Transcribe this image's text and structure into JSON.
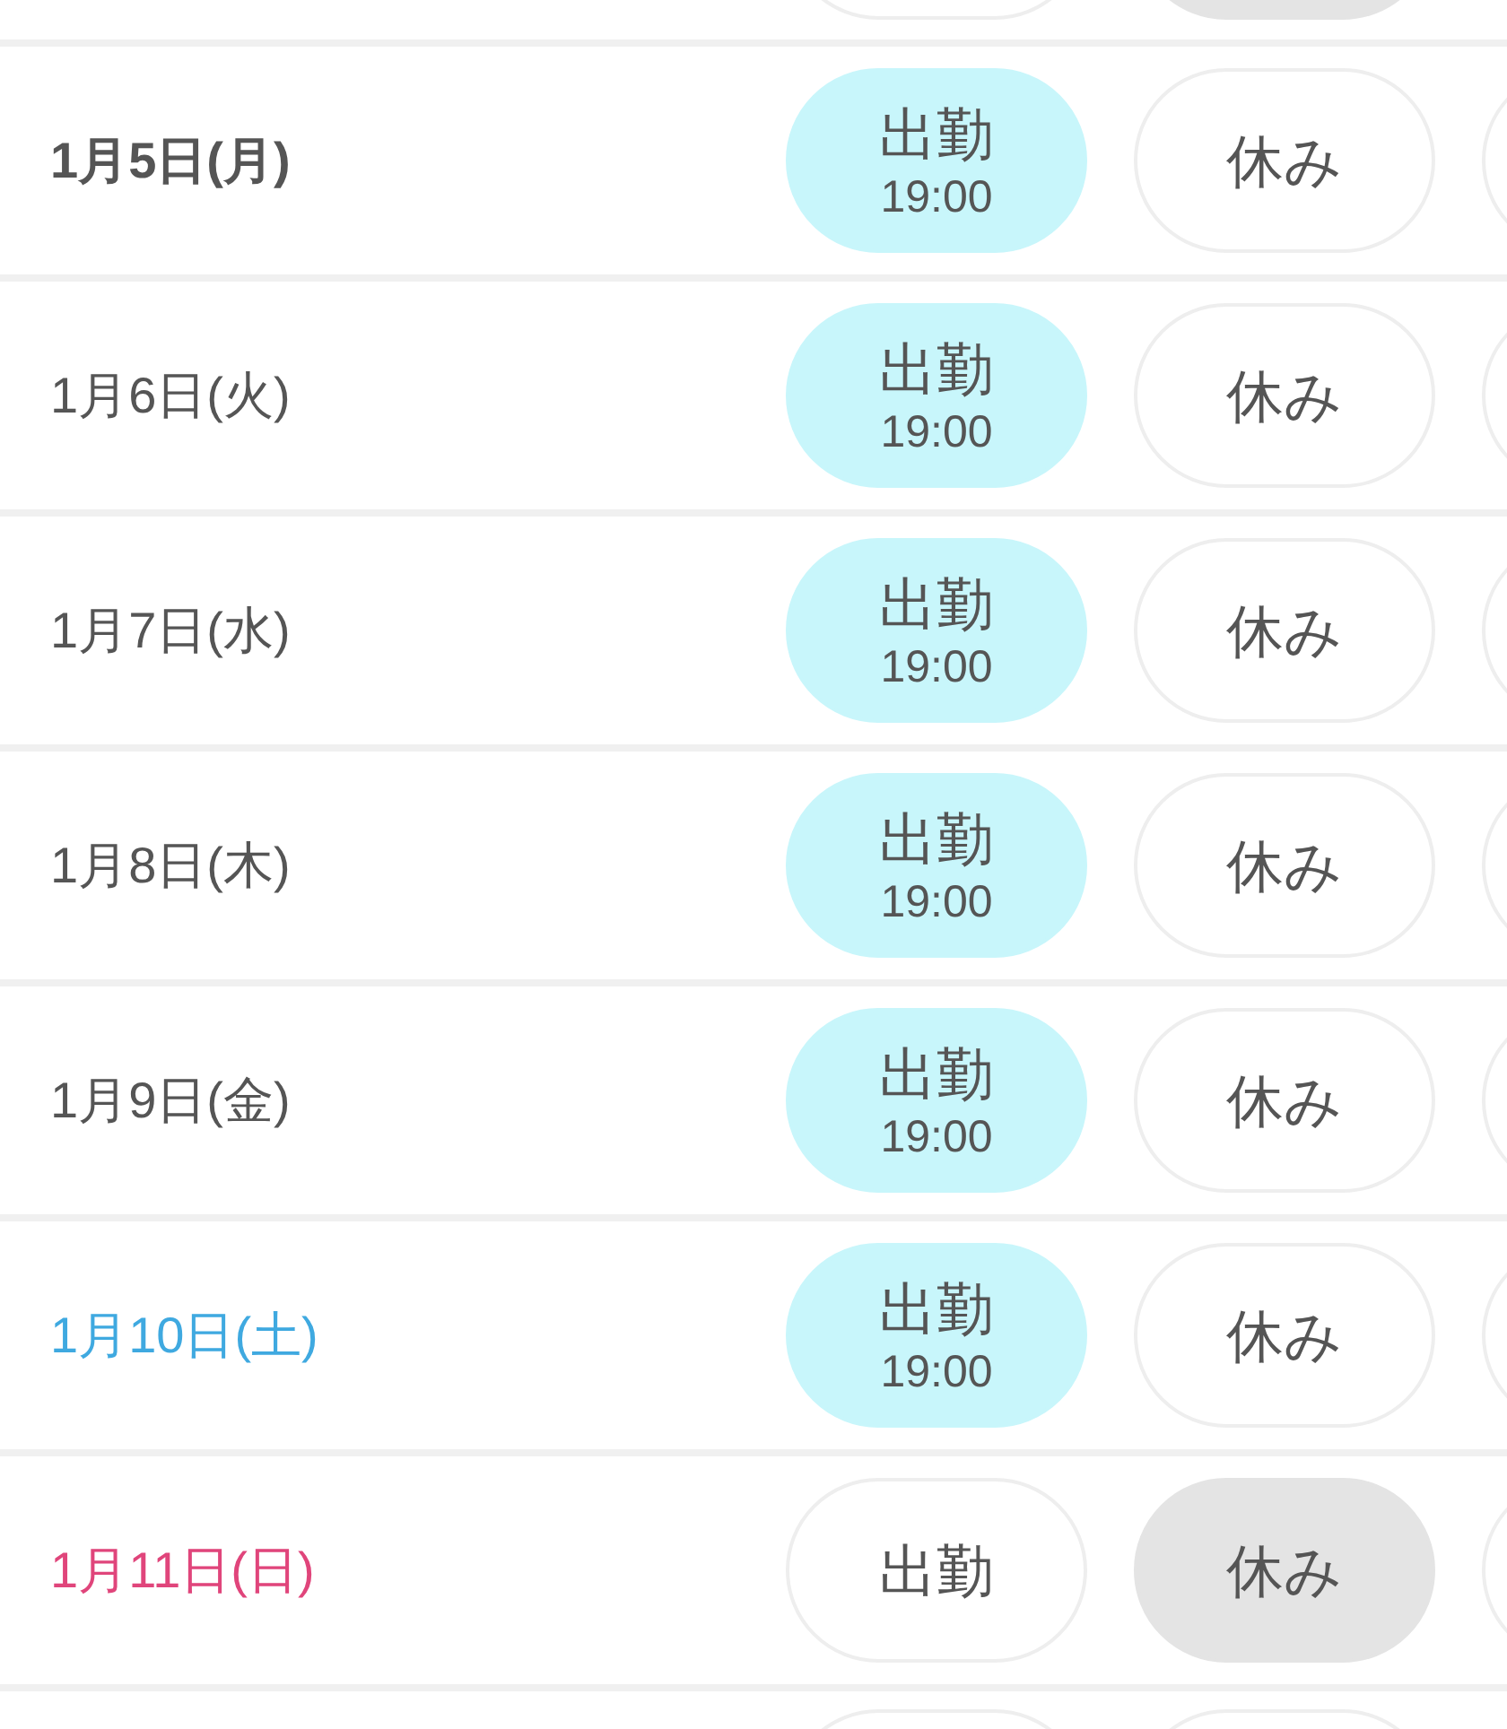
{
  "row_above": {
    "work_selected": false,
    "off_selected": true
  },
  "rows": [
    {
      "date": "1月5日(月)",
      "color": "#555555",
      "today": true,
      "work": {
        "label": "出勤",
        "time": "19:00",
        "selected": true
      },
      "off": {
        "label": "休み",
        "selected": false
      }
    },
    {
      "date": "1月6日(火)",
      "color": "#555555",
      "today": false,
      "work": {
        "label": "出勤",
        "time": "19:00",
        "selected": true
      },
      "off": {
        "label": "休み",
        "selected": false
      }
    },
    {
      "date": "1月7日(水)",
      "color": "#555555",
      "today": false,
      "work": {
        "label": "出勤",
        "time": "19:00",
        "selected": true
      },
      "off": {
        "label": "休み",
        "selected": false
      }
    },
    {
      "date": "1月8日(木)",
      "color": "#555555",
      "today": false,
      "work": {
        "label": "出勤",
        "time": "19:00",
        "selected": true
      },
      "off": {
        "label": "休み",
        "selected": false
      }
    },
    {
      "date": "1月9日(金)",
      "color": "#555555",
      "today": false,
      "work": {
        "label": "出勤",
        "time": "19:00",
        "selected": true
      },
      "off": {
        "label": "休み",
        "selected": false
      }
    },
    {
      "date": "1月10日(土)",
      "color": "#3fa9e0",
      "today": false,
      "work": {
        "label": "出勤",
        "time": "19:00",
        "selected": true
      },
      "off": {
        "label": "休み",
        "selected": false
      }
    },
    {
      "date": "1月11日(日)",
      "color": "#e0457b",
      "today": false,
      "work": {
        "label": "出勤",
        "selected": false
      },
      "off": {
        "label": "休み",
        "selected": true
      }
    }
  ],
  "row_below": {
    "work_selected": false,
    "off_selected": false
  }
}
